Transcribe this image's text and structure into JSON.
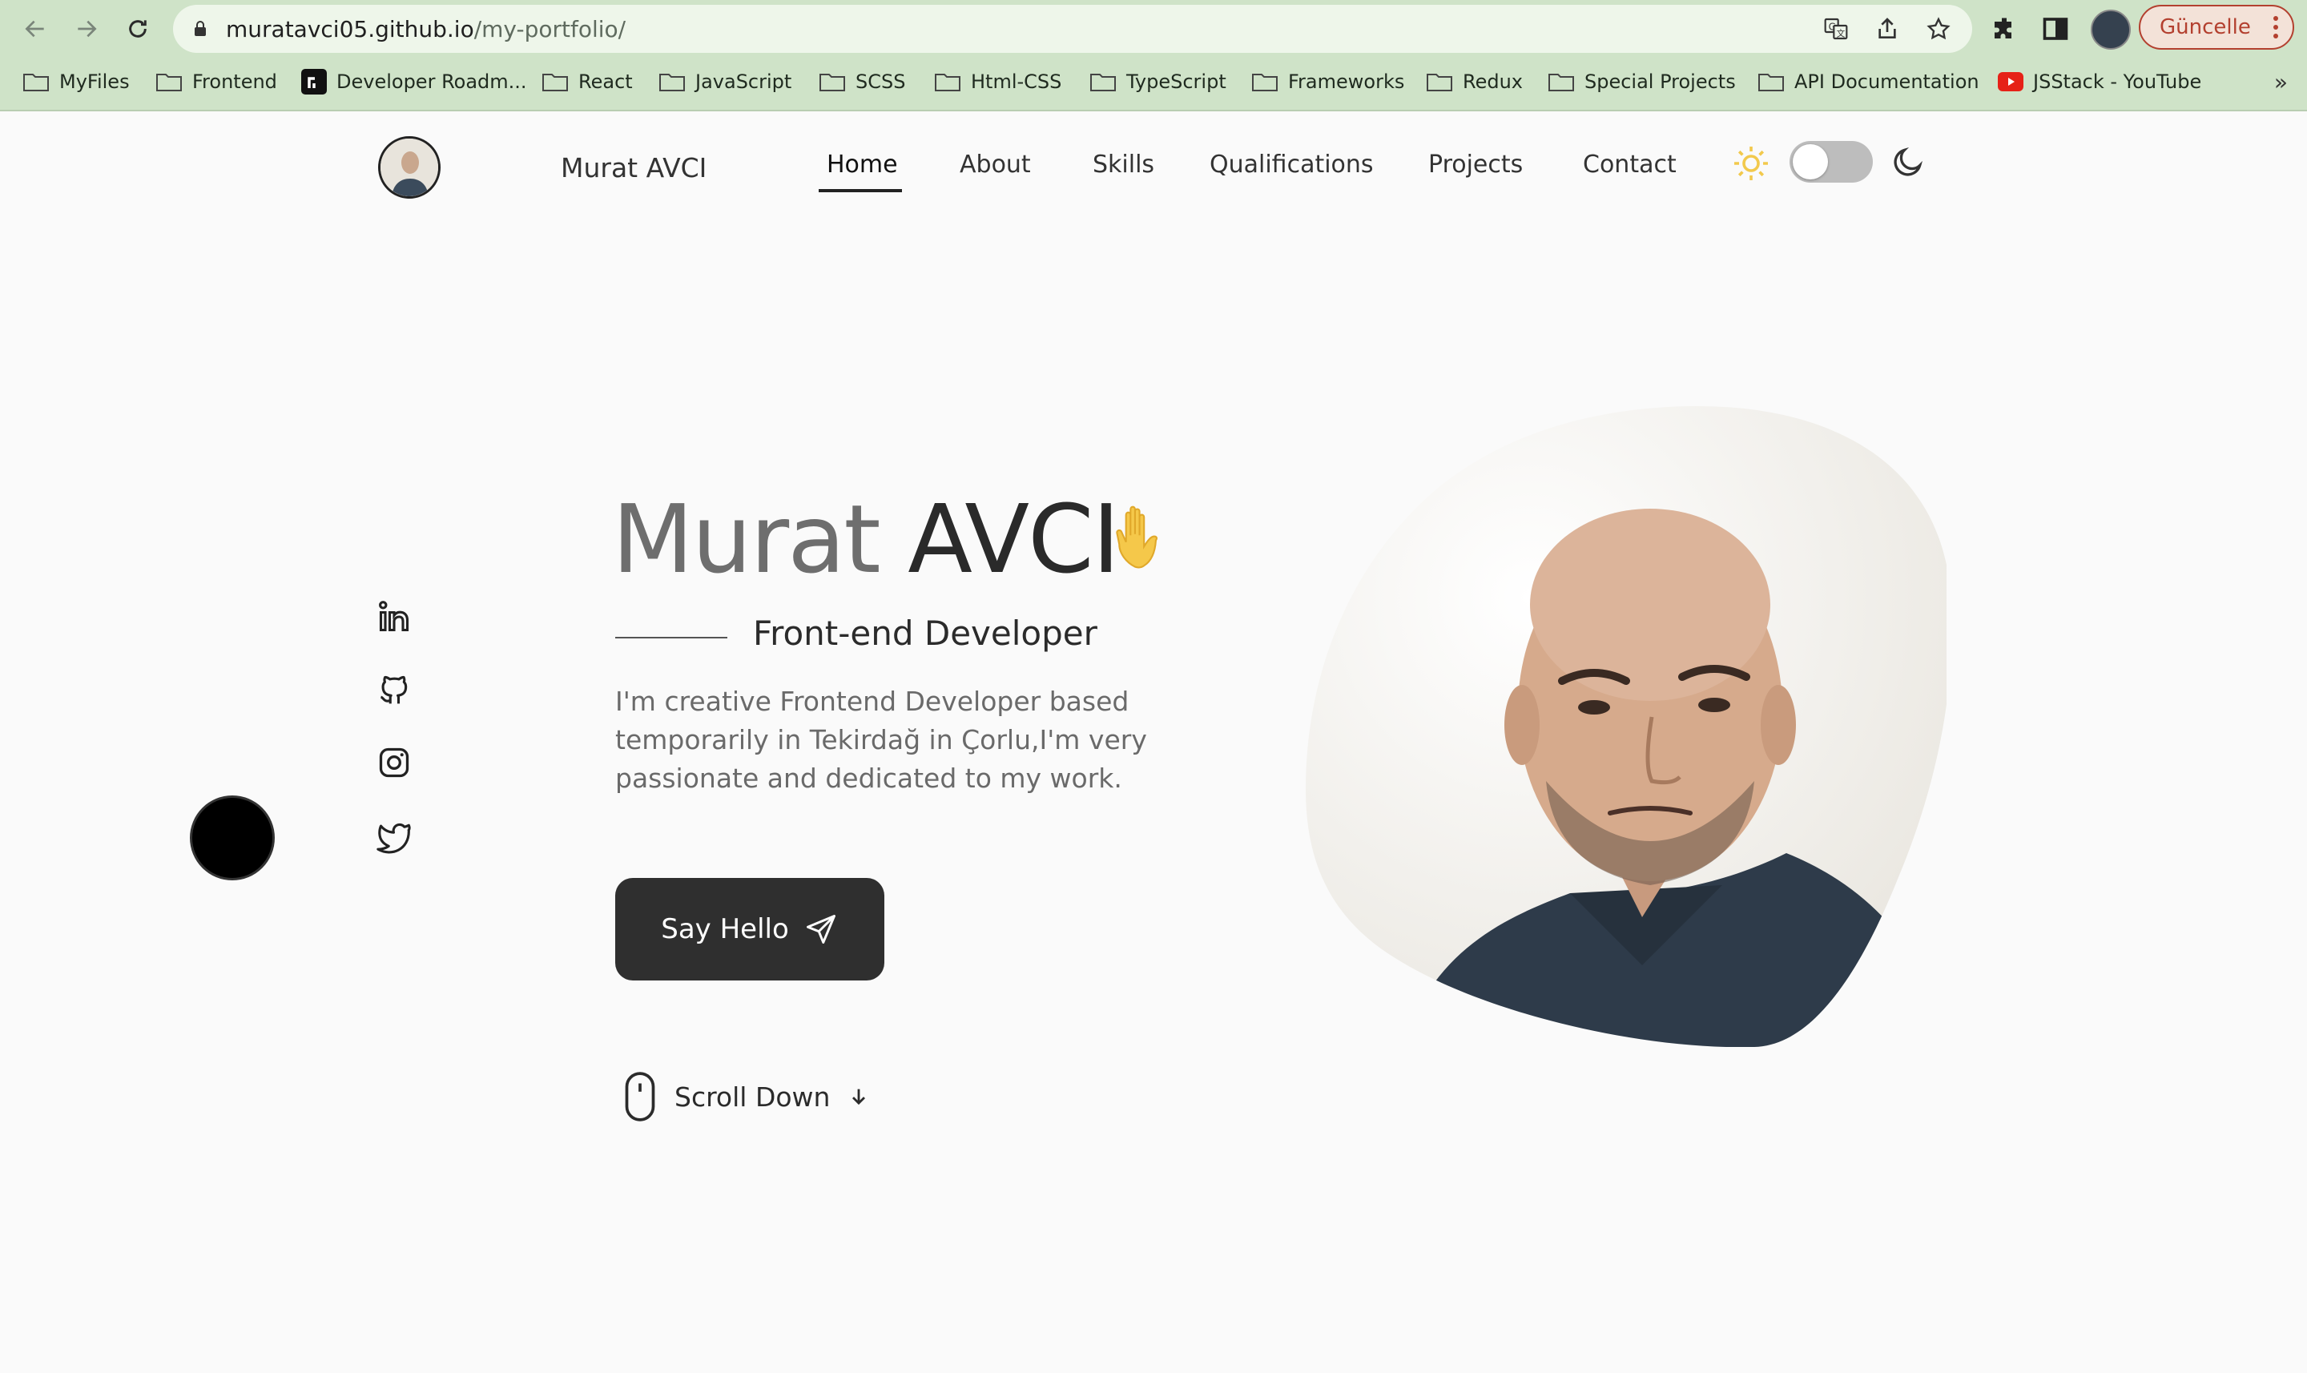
{
  "browser": {
    "url_host": "muratavci05.github.io",
    "url_path": "/my-portfolio/",
    "update_label": "Güncelle",
    "bookmarks": [
      {
        "label": "MyFiles",
        "icon": "folder-icon"
      },
      {
        "label": "Frontend",
        "icon": "folder-icon"
      },
      {
        "label": "Developer Roadm...",
        "icon": "roadmap-logo-icon"
      },
      {
        "label": "React",
        "icon": "folder-icon"
      },
      {
        "label": "JavaScript",
        "icon": "folder-icon"
      },
      {
        "label": "SCSS",
        "icon": "folder-icon"
      },
      {
        "label": "Html-CSS",
        "icon": "folder-icon"
      },
      {
        "label": "TypeScript",
        "icon": "folder-icon"
      },
      {
        "label": "Frameworks",
        "icon": "folder-icon"
      },
      {
        "label": "Redux",
        "icon": "folder-icon"
      },
      {
        "label": "Special Projects",
        "icon": "folder-icon"
      },
      {
        "label": "API Documentation",
        "icon": "folder-icon"
      },
      {
        "label": "JSStack - YouTube",
        "icon": "youtube-icon"
      }
    ],
    "more_label": "»"
  },
  "header": {
    "brand": "Murat AVCI",
    "nav": [
      "Home",
      "About",
      "Skills",
      "Qualifications",
      "Projects",
      "Contact"
    ],
    "active_nav": "Home",
    "theme_toggle": "light"
  },
  "social": [
    "linkedin-icon",
    "github-icon",
    "instagram-icon",
    "twitter-icon"
  ],
  "hero": {
    "first_name": "Murat",
    "last_name": "AVCI",
    "subtitle": "Front-end Developer",
    "description": "I'm creative Frontend Developer based temporarily in Tekirdağ in Çorlu,I'm very passionate and dedicated to my work.",
    "cta": "Say Hello",
    "scroll": "Scroll Down"
  },
  "colors": {
    "chrome_bg": "#cfe3c8",
    "page_bg": "#fafafa",
    "button_bg": "#2f2f2f",
    "sun": "#f2c94c",
    "update_accent": "#b3402f"
  }
}
